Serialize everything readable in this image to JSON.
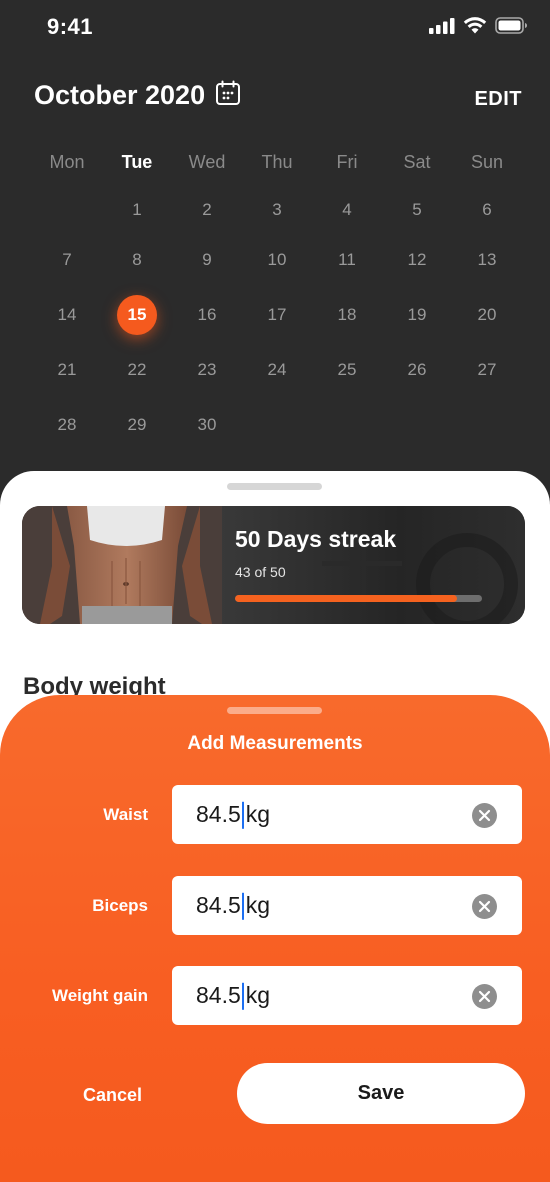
{
  "status_bar": {
    "time": "9:41"
  },
  "calendar": {
    "month_title": "October 2020",
    "edit_label": "EDIT",
    "weekdays": [
      "Mon",
      "Tue",
      "Wed",
      "Thu",
      "Fri",
      "Sat",
      "Sun"
    ],
    "active_weekday": "Tue",
    "selected_day": "15",
    "weeks": [
      [
        "",
        "1",
        "2",
        "3",
        "4",
        "5",
        "6"
      ],
      [
        "7",
        "8",
        "9",
        "10",
        "11",
        "12",
        "13"
      ],
      [
        "14",
        "15",
        "16",
        "17",
        "18",
        "19",
        "20"
      ],
      [
        "21",
        "22",
        "23",
        "24",
        "25",
        "26",
        "27"
      ],
      [
        "28",
        "29",
        "30",
        "",
        "",
        "",
        ""
      ]
    ]
  },
  "streak": {
    "title": "50 Days streak",
    "subtitle": "43 of 50",
    "progress": 0.9
  },
  "section": {
    "body_weight": "Body weight"
  },
  "measurements": {
    "title": "Add Measurements",
    "fields": [
      {
        "label": "Waist",
        "value": "84.5",
        "unit": "kg"
      },
      {
        "label": "Biceps",
        "value": "84.5",
        "unit": "kg"
      },
      {
        "label": "Weight gain",
        "value": "84.5",
        "unit": "kg"
      }
    ],
    "cancel_label": "Cancel",
    "save_label": "Save"
  },
  "colors": {
    "accent": "#f55a1e",
    "dark_bg": "#2b2b2b",
    "track": "#6e6e6e"
  },
  "icons": [
    "signal-icon",
    "wifi-icon",
    "battery-icon",
    "calendar-icon",
    "clear-icon"
  ]
}
